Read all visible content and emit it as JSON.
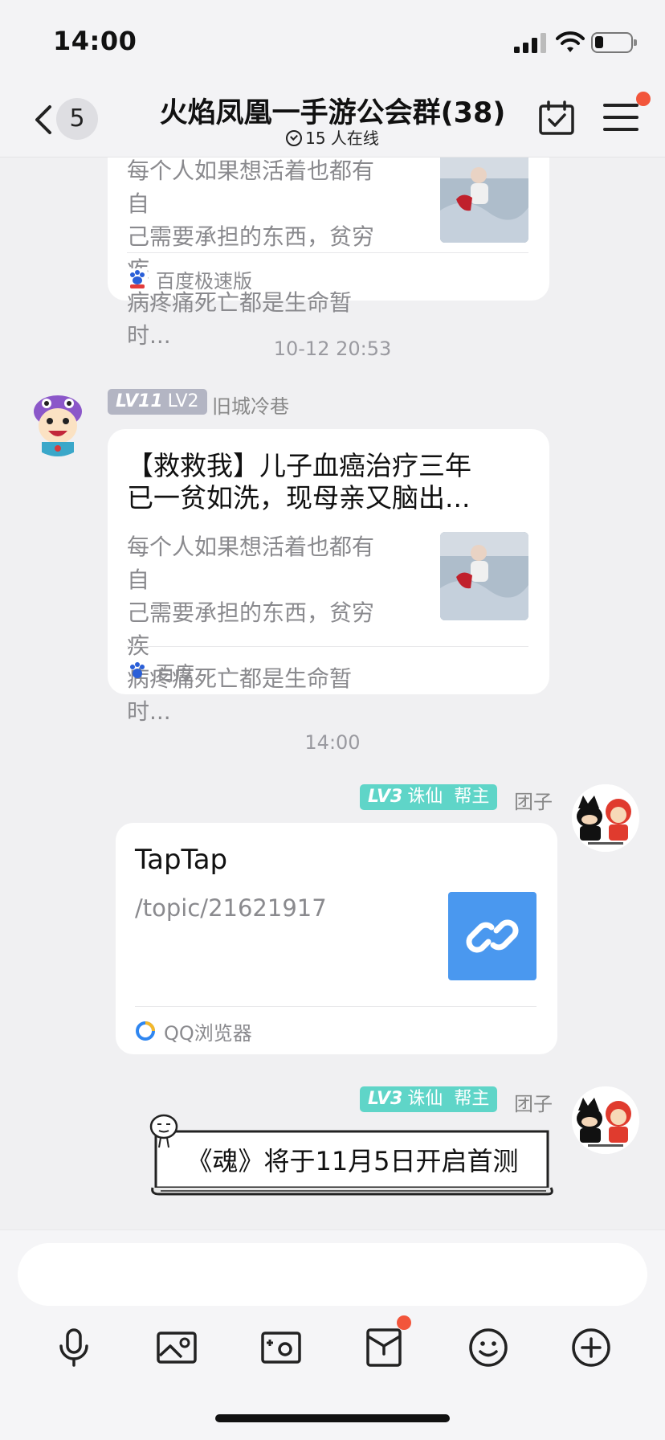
{
  "status_bar": {
    "time": "14:00"
  },
  "header": {
    "back_count": "5",
    "title": "火焰凤凰一手游公会群(38)",
    "online": "15 人在线"
  },
  "messages": [
    {
      "type": "link-card",
      "description_lines": [
        "每个人如果想活着也都有自",
        "己需要承担的东西，贫穷疾",
        "病疼痛死亡都是生命暂时..."
      ],
      "source": "百度极速版"
    },
    {
      "type": "timestamp",
      "text": "10-12 20:53"
    },
    {
      "type": "link-card",
      "sender": {
        "level": "LV11",
        "level_name": "LV2",
        "name": "旧城冷巷"
      },
      "title_lines": [
        "【救救我】儿子血癌治疗三年",
        "已一贫如洗，现母亲又脑出..."
      ],
      "description_lines": [
        "每个人如果想活着也都有自",
        "己需要承担的东西，贫穷疾",
        "病疼痛死亡都是生命暂时..."
      ],
      "source": "百度"
    },
    {
      "type": "timestamp",
      "text": "14:00"
    },
    {
      "type": "link-card",
      "sender": {
        "level": "LV3",
        "level_name": "诛仙",
        "role": "帮主",
        "name": "团子"
      },
      "title": "TapTap",
      "description": "/topic/21621917",
      "source": "QQ浏览器"
    },
    {
      "type": "banner",
      "sender": {
        "level": "LV3",
        "level_name": "诛仙",
        "role": "帮主",
        "name": "团子"
      },
      "text": "《魂》将于11月5日开启首测"
    }
  ],
  "colors": {
    "lv_gray": "#b3b5c3",
    "lv_teal": "#5fd5c8",
    "link_blue": "#4a98ef",
    "notify_red": "#f2553b"
  },
  "toolbar_icons": [
    "microphone-icon",
    "image-icon",
    "camera-icon",
    "red-packet-icon",
    "emoji-icon",
    "plus-icon"
  ]
}
